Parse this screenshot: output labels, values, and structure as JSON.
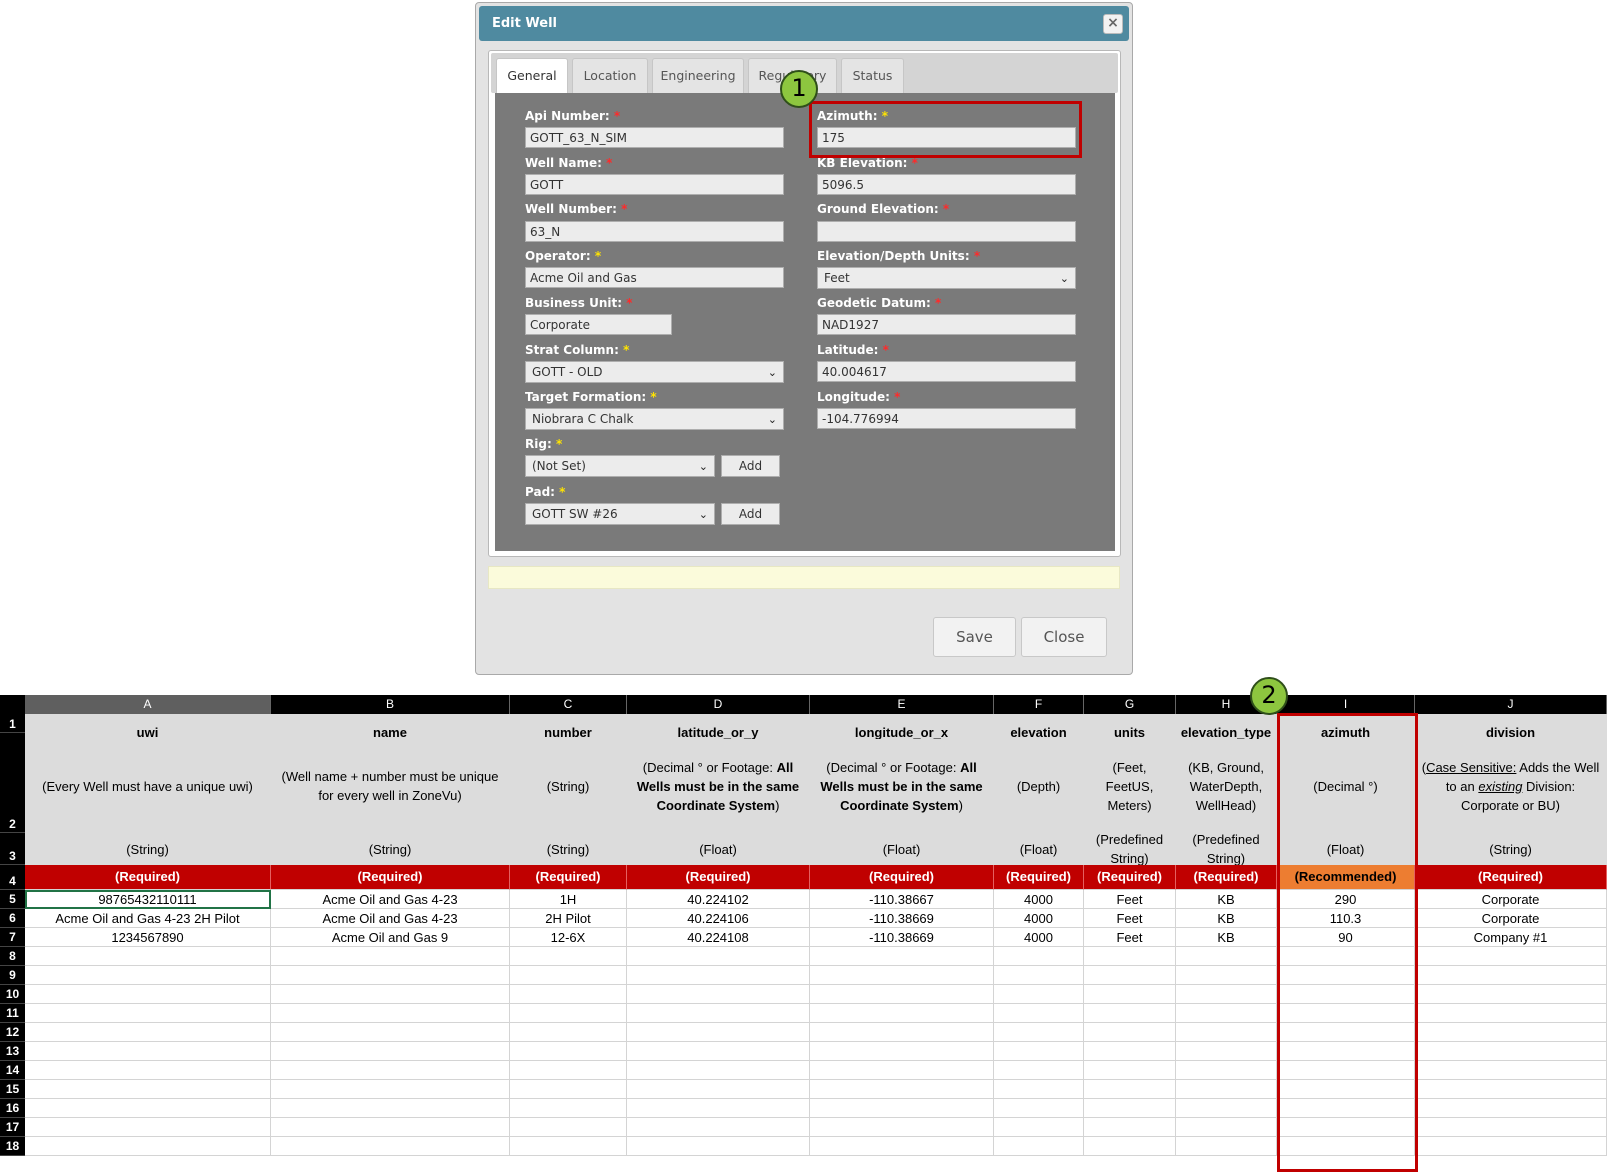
{
  "dialog": {
    "title": "Edit Well",
    "tabs": [
      "General",
      "Location",
      "Engineering",
      "Regulatory",
      "Status"
    ],
    "left_fields": [
      {
        "label": "Api Number:",
        "value": "GOTT_63_N_SIM"
      },
      {
        "label": "Well Name:",
        "value": "GOTT"
      },
      {
        "label": "Well Number:",
        "value": "63_N"
      },
      {
        "label": "Operator:",
        "value": "Acme Oil and Gas"
      },
      {
        "label": "Business Unit:",
        "value": "Corporate"
      },
      {
        "label": "Strat Column:",
        "value": "GOTT - OLD"
      },
      {
        "label": "Target Formation:",
        "value": "Niobrara C Chalk"
      },
      {
        "label": "Rig:",
        "value": "(Not Set)"
      },
      {
        "label": "Pad:",
        "value": "GOTT SW #26"
      }
    ],
    "right_fields": [
      {
        "label": "Azimuth:",
        "value": "175"
      },
      {
        "label": "KB Elevation:",
        "value": "5096.5"
      },
      {
        "label": "Ground Elevation:",
        "value": ""
      },
      {
        "label": "Elevation/Depth Units:",
        "value": "Feet"
      },
      {
        "label": "Geodetic Datum:",
        "value": "NAD1927"
      },
      {
        "label": "Latitude:",
        "value": "40.004617"
      },
      {
        "label": "Longitude:",
        "value": "-104.776994"
      }
    ],
    "required_marker": "*",
    "add_label": "Add",
    "save_label": "Save",
    "close_label": "Close",
    "close_icon": "×"
  },
  "badges": [
    "1",
    "2"
  ],
  "sheet": {
    "columns": [
      "A",
      "B",
      "C",
      "D",
      "E",
      "F",
      "G",
      "H",
      "I",
      "J"
    ],
    "row_numbers": [
      "1",
      "2",
      "3",
      "4",
      "5",
      "6",
      "7",
      "8",
      "9",
      "10",
      "11",
      "12",
      "13",
      "14",
      "15",
      "16",
      "17",
      "18"
    ],
    "field_names": [
      "uwi",
      "name",
      "number",
      "latitude_or_y",
      "longitude_or_x",
      "elevation",
      "units",
      "elevation_type",
      "azimuth",
      "division"
    ],
    "descriptions": [
      "(Every Well must have a unique uwi)",
      "(Well name + number must be unique for every well in ZoneVu)",
      "(String)",
      "",
      "",
      "(Depth)",
      "(Feet, FeetUS, Meters)",
      "(KB, Ground, WaterDepth, WellHead)",
      "(Decimal °)",
      ""
    ],
    "coord_desc": {
      "prefix": "(Decimal ° or Footage: ",
      "bold": "All Wells must be in the same Coordinate System",
      "suffix": ")"
    },
    "division_desc": {
      "u1": "Case Sensitive:",
      "t1": " Adds the Well to an ",
      "u2": "existing",
      "t2": " Division: Corporate or BU)",
      "open": "("
    },
    "types": [
      "(String)",
      "(String)",
      "(String)",
      "(Float)",
      "(Float)",
      "(Float)",
      "(Predefined String)",
      "(Predefined String)",
      "(Float)",
      "(String)"
    ],
    "requirements": [
      "(Required)",
      "(Required)",
      "(Required)",
      "(Required)",
      "(Required)",
      "(Required)",
      "(Required)",
      "(Required)",
      "(Recommended)",
      "(Required)"
    ],
    "rows": [
      [
        "98765432110111",
        "Acme Oil and Gas 4-23",
        "1H",
        "40.224102",
        "-110.38667",
        "4000",
        "Feet",
        "KB",
        "290",
        "Corporate"
      ],
      [
        "Acme Oil and Gas 4-23 2H Pilot",
        "Acme Oil and Gas 4-23",
        "2H Pilot",
        "40.224106",
        "-110.38669",
        "4000",
        "Feet",
        "KB",
        "110.3",
        "Corporate"
      ],
      [
        "1234567890",
        "Acme Oil and Gas 9",
        "12-6X",
        "40.224108",
        "-110.38669",
        "4000",
        "Feet",
        "KB",
        "90",
        "Company #1"
      ]
    ],
    "colors": {
      "required": "#c00000",
      "recommended": "#ed7d31",
      "header_bg": "#dcdcdc",
      "callout": "#c00000",
      "badge": "#8dc63f",
      "titlebar": "#4f8aa0"
    }
  }
}
